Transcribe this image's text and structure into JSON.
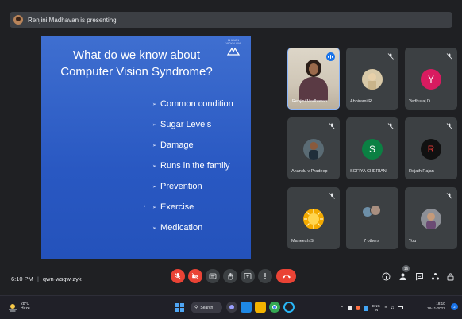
{
  "banner": {
    "text": "Renjini Madhavan is presenting"
  },
  "slide": {
    "title_line1": "What do we know about",
    "title_line2": "Computer Vision Syndrome?",
    "logo_text": "BHAVAN VIDYALAYA",
    "bullets": [
      "Common condition",
      "Sugar Levels",
      "Damage",
      "Runs in the family",
      "Prevention",
      "Exercise",
      "Medication"
    ],
    "highlighted_bullet": 5,
    "bg_color": "#2958c2"
  },
  "participants": [
    {
      "name": "Renjini Madhavan",
      "type": "video",
      "speaking": true
    },
    {
      "name": "Abhirami R",
      "type": "photo",
      "muted": true
    },
    {
      "name": "Yedhuraj D",
      "type": "letter",
      "letter": "Y",
      "color": "#d81b60",
      "muted": true
    },
    {
      "name": "Anandu v Pradeep",
      "type": "photo",
      "muted": true
    },
    {
      "name": "SOFIYA CHERIAN",
      "type": "letter",
      "letter": "S",
      "color": "#0b8043",
      "muted": true
    },
    {
      "name": "Rejath Rajan",
      "type": "letter",
      "letter": "R",
      "color": "#111111",
      "muted": true
    },
    {
      "name": "Maneesh S",
      "type": "photo",
      "muted": true
    },
    {
      "name": "7 others",
      "type": "group",
      "muted": false
    },
    {
      "name": "You",
      "type": "photo",
      "muted": true
    }
  ],
  "meeting": {
    "time": "6:10 PM",
    "code": "qwn-wsgw-zyk",
    "people_count": "16"
  },
  "controls": {
    "mic_state": "off",
    "camera_state": "off",
    "accent_red": "#ea4335"
  },
  "taskbar": {
    "weather_temp": "28°C",
    "weather_desc": "Haze",
    "search_label": "Search",
    "lang_line1": "ENG",
    "lang_line2": "IN",
    "time": "18:10",
    "date": "18-11-2022",
    "notification_count": "2"
  }
}
